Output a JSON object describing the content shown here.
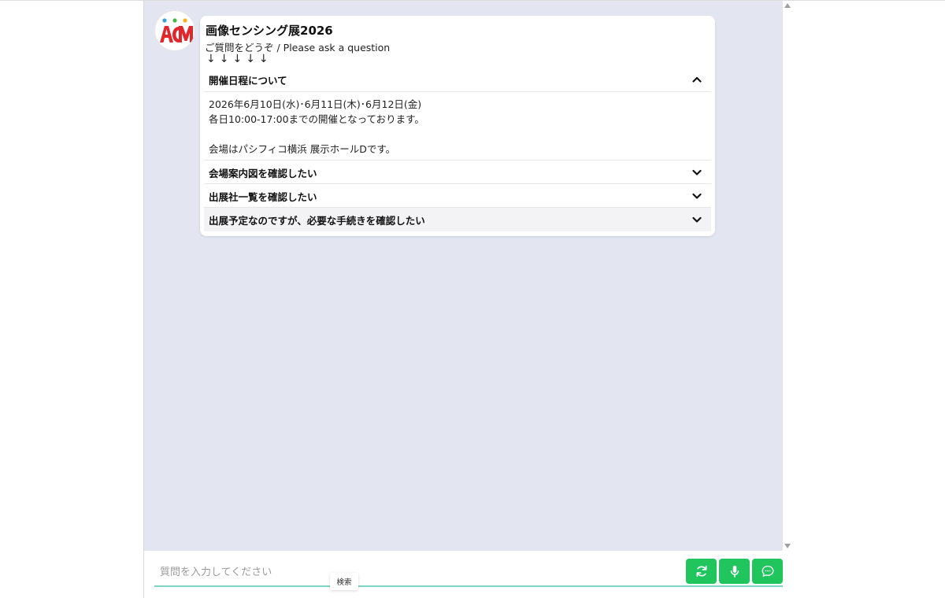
{
  "header": {
    "title": "画像センシング展2026",
    "subtitle": "ご質問をどうぞ / Please ask a question",
    "arrows": "↓↓↓↓↓"
  },
  "logo": {
    "text": "ACM",
    "dot_colors": [
      "#3aa0e0",
      "#49b849",
      "#f2b21b"
    ],
    "letter_color": "#e1262c"
  },
  "faq": {
    "items": [
      {
        "label": "開催日程について",
        "expanded": true,
        "answer_line1": "2026年6月10日(水)･6月11日(木)･6月12日(金)",
        "answer_line2": "各日10:00-17:00までの開催となっております。",
        "answer_line3": "会場はパシフィコ横浜 展示ホールDです。"
      },
      {
        "label": "会場案内図を確認したい",
        "expanded": false
      },
      {
        "label": "出展社一覧を確認したい",
        "expanded": false
      },
      {
        "label": "出展予定なのですが、必要な手続きを確認したい",
        "expanded": false
      }
    ]
  },
  "input": {
    "placeholder": "質問を入力してください",
    "value": "",
    "tooltip": "検索"
  },
  "buttons": {
    "refresh_icon": "refresh-icon",
    "mic_icon": "microphone-icon",
    "send_icon": "chat-bubble-icon",
    "color": "#21c55e"
  },
  "colors": {
    "chat_background": "#e3e6f1",
    "accent": "#7fd3c1"
  }
}
